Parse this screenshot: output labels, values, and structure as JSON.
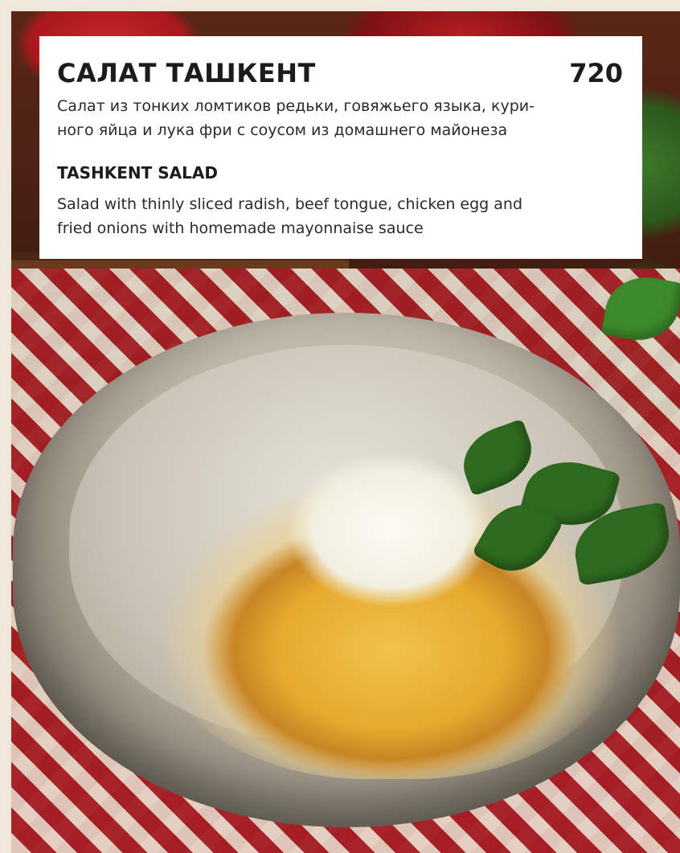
{
  "dish": {
    "title_ru": "САЛАТ ТАШКЕНТ",
    "price": "720",
    "description_ru_lines": [
      "Салат из тонких ломтиков редьки, говяжьего языка, кури-",
      "ного яйца и лука фри с соусом из домашнего майонеза"
    ],
    "title_en": "TASHKENT SALAD",
    "description_en_lines": [
      "Salad with thinly sliced radish, beef tongue, chicken egg and",
      "fried onions with homemade mayonnaise sauce"
    ]
  },
  "colors": {
    "card_background": "#ffffff",
    "text": "#1c1c1c",
    "tablecloth_red": "#a51e23",
    "page_background": "#efe7d9"
  }
}
